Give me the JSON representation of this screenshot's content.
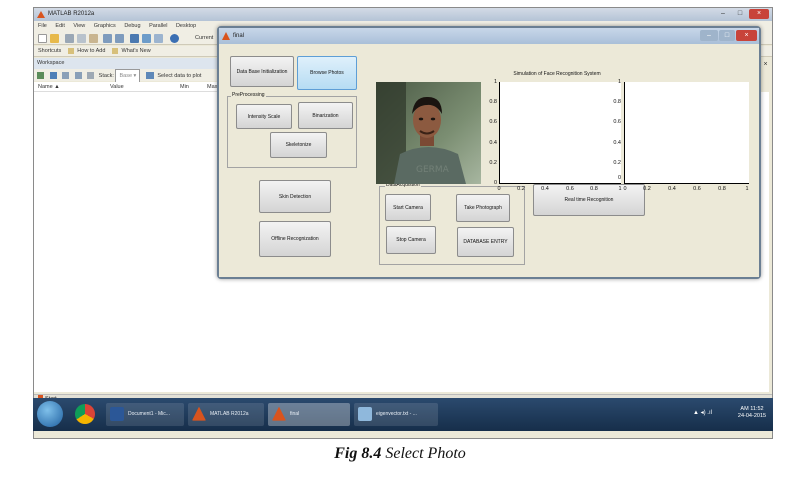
{
  "matlab": {
    "title": "MATLAB R2012a",
    "window_buttons": {
      "minimize": "–",
      "maximize": "□",
      "close": "×"
    },
    "menu": [
      "File",
      "Edit",
      "View",
      "Graphics",
      "Debug",
      "Parallel",
      "Desktop"
    ],
    "current_label": "Current",
    "shortcuts": {
      "label": "Shortcuts",
      "how_to_add": "How to Add",
      "whats_new": "What's New"
    },
    "workspace": {
      "header": "Workspace",
      "stack_label": "Stack:",
      "stack_value": "Base",
      "select_data": "Select data to plot",
      "columns": [
        "Name ▲",
        "Value",
        "Min",
        "Max"
      ]
    },
    "start": "Start"
  },
  "taskbar": {
    "items": [
      {
        "label": ""
      },
      {
        "label": ""
      },
      {
        "label": "Document1 - Mic..."
      },
      {
        "label": "MATLAB R2012a"
      },
      {
        "label": "final"
      },
      {
        "label": "eigenvector.txt - ..."
      }
    ],
    "clock_time": "AM 11:52",
    "clock_date": "24-04-2015",
    "tray": "▲ ◂) .ıl"
  },
  "figure": {
    "title": "final",
    "plot_title": "Simulation of Face Recognition System",
    "buttons": {
      "db_init": "Data Base Initialization",
      "browse": "Browse Photos",
      "intensity": "Intensity Scale",
      "binarization": "Binarization",
      "skeletonize": "Skeletonize",
      "skin": "Skin Detection",
      "offline": "Offline Recognization",
      "start_camera": "Start Camera",
      "take_photo": "Take Photograph",
      "stop_camera": "Stop Camera",
      "db_entry": "DATABASE ENTRY",
      "realtime": "Real time Recognition"
    },
    "panels": {
      "preprocessing": "PreProcessing",
      "data_acquisition": "DataAcquistion"
    },
    "axes1": {
      "yticks": [
        "1",
        "0.8",
        "0.6",
        "0.4",
        "0.2",
        "0"
      ],
      "xticks": [
        "0",
        "0.2",
        "0.4",
        "0.6",
        "0.8",
        "1"
      ]
    },
    "axes2": {
      "yticks": [
        "1",
        "0.8",
        "0.6",
        "0.4",
        "0.2",
        "0"
      ],
      "xticks": [
        "0",
        "0.2",
        "0.4",
        "0.6",
        "0.8",
        "1"
      ]
    }
  },
  "caption": {
    "prefix": "Fig 8.4",
    "text": " Select Photo"
  }
}
